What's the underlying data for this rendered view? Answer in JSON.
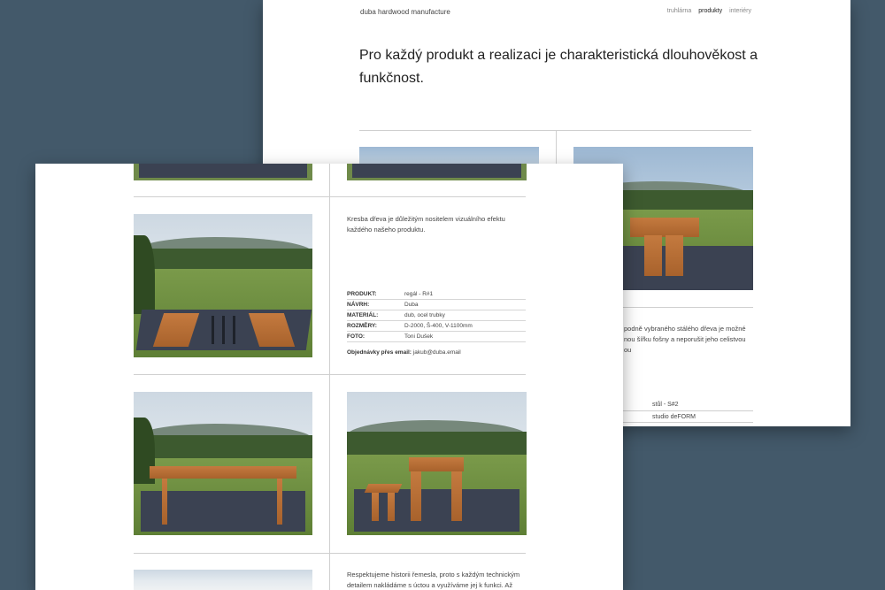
{
  "back": {
    "brand": "duba hardwood manufacture",
    "nav": [
      "truhlárna",
      "produkty",
      "interiéry"
    ],
    "active_nav": "produkty",
    "headline": "Pro každý produkt a realizaci je charakteristická dlouhověkost a funkčnost.",
    "desc": "podně vybraného stálého dřeva je možné\nnou šířku fošny a neporušit jeho celistvou\nou",
    "spec_value_1": "stůl - S#2",
    "spec_value_2": "studio deFORM"
  },
  "front": {
    "desc1": "Kresba dřeva je důležitým nositelem vizuálního efektu každého našeho produktu.",
    "spec": [
      {
        "k": "PRODUKT:",
        "v": "regál - R#1"
      },
      {
        "k": "NÁVRH:",
        "v": "Duba"
      },
      {
        "k": "MATERIÁL:",
        "v": "dub, ocel trubky"
      },
      {
        "k": "ROZMĚRY:",
        "v": "D-2000, Š-400, V-1100mm"
      },
      {
        "k": "FOTO:",
        "v": "Toni Dušek"
      }
    ],
    "order_label": "Objednávky přes email:",
    "order_email": "jakub@duba.email",
    "desc2": "Respektujeme historii řemesla, proto s každým technickým detailem nakládáme s úctou a využíváme jej k funkci. Až"
  },
  "colors": {
    "background": "#43596a",
    "platform": "#3b4252",
    "wood": "#b86d35"
  }
}
